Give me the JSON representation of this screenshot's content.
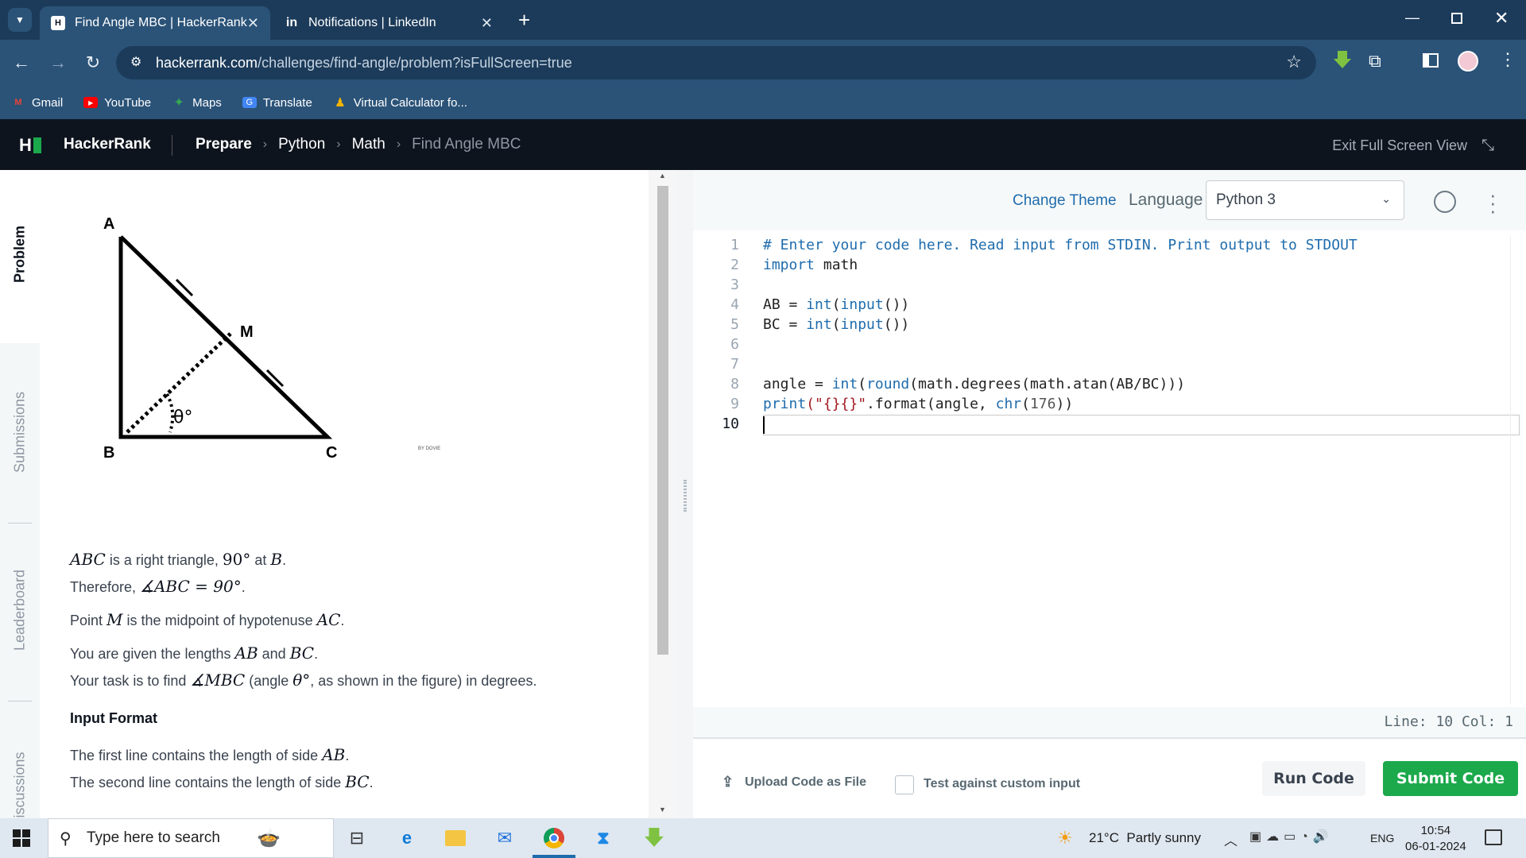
{
  "browser": {
    "tabs": [
      {
        "title": "Find Angle MBC | HackerRank",
        "favicon": "HR"
      },
      {
        "title": "Notifications | LinkedIn",
        "favicon": "in"
      }
    ],
    "url_host": "hackerrank.com",
    "url_path": "/challenges/find-angle/problem?isFullScreen=true",
    "bookmarks": [
      "Gmail",
      "YouTube",
      "Maps",
      "Translate",
      "Virtual Calculator fo..."
    ]
  },
  "hr": {
    "brand": "HackerRank",
    "crumbs": [
      "Prepare",
      "Python",
      "Math",
      "Find Angle MBC"
    ],
    "exit_fullscreen": "Exit Full Screen View"
  },
  "sidetabs": [
    "Problem",
    "Submissions",
    "Leaderboard",
    "iscussions"
  ],
  "figure": {
    "labels": {
      "a": "A",
      "b": "B",
      "c": "C",
      "m": "M",
      "theta": "θ°"
    },
    "watermark": "BY DOVIE"
  },
  "problem": {
    "l1_sym": "ABC",
    "l1_a": " is a right triangle, ",
    "l1_deg": "90°",
    "l1_b": " at ",
    "l1_sym2": "B",
    "l1_c": ".",
    "l2_a": "Therefore, ",
    "l2_math": "∡ABC = 90°",
    "l2_b": ".",
    "l3_a": "Point ",
    "l3_sym": "M",
    "l3_b": " is the midpoint of hypotenuse ",
    "l3_sym2": "AC",
    "l3_c": ".",
    "l4_a": "You are given the lengths ",
    "l4_sym": "AB",
    "l4_b": " and ",
    "l4_sym2": "BC",
    "l4_c": ".",
    "l5_a": "Your task is to find ",
    "l5_math": "∡MBC",
    "l5_b": " (angle ",
    "l5_theta": "θ°",
    "l5_c": ", as shown in the figure) in degrees.",
    "input_format": "Input Format",
    "l6_a": "The first line contains the length of side ",
    "l6_sym": "AB",
    "l6_b": ".",
    "l7_a": "The second line contains the length of side ",
    "l7_sym": "BC",
    "l7_b": "."
  },
  "editor": {
    "change_theme": "Change Theme",
    "language_label": "Language",
    "language": "Python 3",
    "line_numbers": [
      "1",
      "2",
      "3",
      "4",
      "5",
      "6",
      "7",
      "8",
      "9",
      "10"
    ],
    "code": {
      "l1": "# Enter your code here. Read input from STDIN. Print output to STDOUT",
      "l2_kw": "import",
      "l2_rest": " math",
      "l4_a": "AB = ",
      "l4_b": "int",
      "l4_c": "(",
      "l4_d": "input",
      "l4_e": "())",
      "l5_a": "BC = ",
      "l5_b": "int",
      "l5_c": "(",
      "l5_d": "input",
      "l5_e": "())",
      "l8_a": "angle = ",
      "l8_b": "int",
      "l8_c": "(",
      "l8_d": "round",
      "l8_e": "(math.degrees(math.atan(AB/BC)))",
      "l9_a": "print",
      "l9_b": "(\"{}{}\"",
      "l9_c": ".format(angle, ",
      "l9_d": "chr",
      "l9_e": "(",
      "l9_f": "176",
      "l9_g": "))"
    },
    "status": "Line: 10 Col: 1"
  },
  "actions": {
    "upload": "Upload Code as File",
    "custom_input": "Test against custom input",
    "run": "Run Code",
    "submit": "Submit Code"
  },
  "taskbar": {
    "search_placeholder": "Type here to search",
    "weather": "21°C  Partly sunny",
    "lang": "ENG",
    "time": "10:54",
    "date": "06-01-2024"
  },
  "colors": {
    "brand_green": "#1ba94c",
    "nav_dark": "#0e141e",
    "link_blue": "#1f6cad"
  }
}
